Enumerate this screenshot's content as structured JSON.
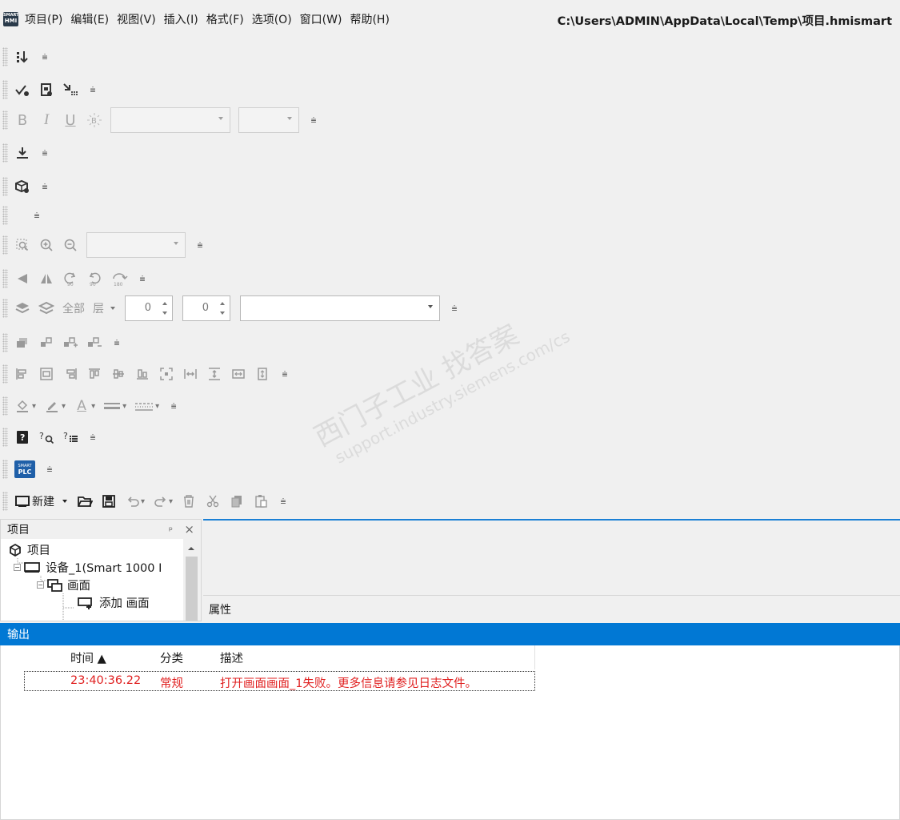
{
  "menu": {
    "logo_top": "SMART",
    "logo_bottom": "HMI",
    "items": [
      "项目(P)",
      "编辑(E)",
      "视图(V)",
      "插入(I)",
      "格式(F)",
      "选项(O)",
      "窗口(W)",
      "帮助(H)"
    ],
    "path": "C:\\Users\\ADMIN\\AppData\\Local\\Temp\\项目.hmismart"
  },
  "toolbar": {
    "overflow_glyph": "⩧",
    "text_format": {
      "bold": "B",
      "italic": "I",
      "underline": "U"
    },
    "layers": {
      "all_label": "全部",
      "layer_label": "层",
      "spin1_value": "0",
      "spin2_value": "0"
    },
    "font_color_glyph": "A",
    "plc_logo_top": "SMART",
    "plc_logo_bottom": "PLC",
    "new_label": "新建"
  },
  "project_panel": {
    "title": "项目",
    "pin_glyph": "ᵖ",
    "close_glyph": "×",
    "tree": [
      {
        "label": "项目",
        "level": 0
      },
      {
        "label": "设备_1(Smart 1000 I",
        "level": 1
      },
      {
        "label": "画面",
        "level": 2
      },
      {
        "label": "添加 画面",
        "level": 3
      }
    ]
  },
  "properties_panel": {
    "title": "属性"
  },
  "output": {
    "title": "输出",
    "columns": {
      "time": "时间 ▲",
      "category": "分类",
      "description": "描述"
    },
    "rows": [
      {
        "time": "23:40:36.22",
        "category": "常规",
        "description": "打开画面画面_1失败。更多信息请参见日志文件。"
      }
    ]
  },
  "watermark": {
    "line1": "西门子工业  找答案",
    "line2": "support.industry.siemens.com/cs"
  },
  "colors": {
    "accent": "#0178d4",
    "error_text": "#e02020",
    "editor_border": "#1b80d5"
  }
}
